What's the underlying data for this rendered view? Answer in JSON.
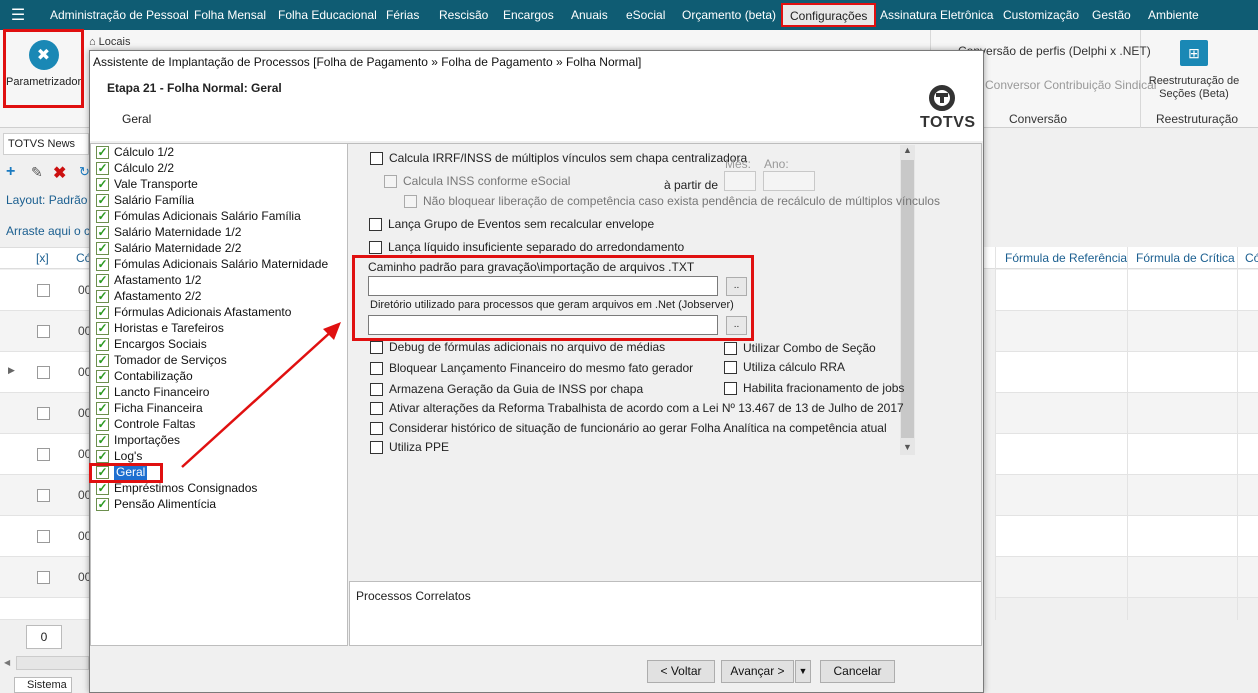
{
  "menu": {
    "items": [
      "Administração de Pessoal",
      "Folha Mensal",
      "Folha Educacional",
      "Férias",
      "Rescisão",
      "Encargos",
      "Anuais",
      "eSocial",
      "Orçamento (beta)",
      "Configurações",
      "Assinatura Eletrônica",
      "Customização",
      "Gestão",
      "Ambiente"
    ],
    "active": "Configurações"
  },
  "ribbon": {
    "parametrizador": "Parametrizador",
    "locais": "Locais",
    "conversao_perfis": "Conversão de perfis (Delphi x .NET)",
    "conversor_contrib": "Conversor Contribuição Sindical",
    "conversao_group": "Conversão",
    "reestruturacao": "Reestruturação de Seções (Beta)",
    "reestruturacao_group": "Reestruturação"
  },
  "background": {
    "news_tab": "TOTVS News",
    "layout_label": "Layout:",
    "layout_value": "Padrão",
    "drag_hint": "Arraste aqui o ca",
    "col_check": "[x]",
    "col_code": "Có",
    "row_code": "00",
    "right_headers": [
      "Fórmula de Referência",
      "Fórmula de Crítica",
      "Có"
    ],
    "page_number": "0",
    "bottom_tab": "Sistema"
  },
  "dialog": {
    "title": "Assistente de Implantação de Processos [Folha de Pagamento » Folha de Pagamento » Folha Normal]",
    "step_title": "Etapa 21 - Folha Normal: Geral",
    "step_subtitle": "Geral",
    "brand": "TOTVS",
    "tree": [
      "Cálculo 1/2",
      "Cálculo 2/2",
      "Vale Transporte",
      "Salário Família",
      "Fómulas Adicionais Salário Família",
      "Salário Maternidade 1/2",
      "Salário Maternidade 2/2",
      "Fómulas Adicionais Salário Maternidade",
      "Afastamento 1/2",
      "Afastamento 2/2",
      "Fórmulas Adicionais Afastamento",
      "Horistas e Tarefeiros",
      "Encargos Sociais",
      "Tomador de Serviços",
      "Contabilização",
      "Lancto Financeiro",
      "Ficha Financeira",
      "Controle Faltas",
      "Importações",
      "Log's",
      "Geral",
      "Empréstimos Consignados",
      "Pensão Alimentícia"
    ],
    "tree_selected": "Geral",
    "options": {
      "calc_irrf": "Calcula IRRF/INSS de múltiplos vínculos sem chapa centralizadora",
      "calc_inss": "Calcula INSS conforme eSocial",
      "a_partir_de": "à partir de",
      "mes": "Mês:",
      "ano": "Ano:",
      "nao_bloquear": "Não bloquear liberação de competência caso exista pendência de recálculo de múltiplos vínculos",
      "lanca_grupo": "Lança Grupo de Eventos sem recalcular envelope",
      "lanca_liquido": "Lança líquido insuficiente separado do arredondamento",
      "caminho_txt": "Caminho padrão para gravação\\importação de arquivos .TXT",
      "diretorio_net": "Diretório utilizado para processos que geram arquivos em .Net (Jobserver)",
      "browse": "..",
      "debug_formulas": "Debug de fórmulas adicionais no arquivo de médias",
      "bloquear_lanc": "Bloquear Lançamento Financeiro do mesmo fato gerador",
      "armazena_guia": "Armazena Geração da Guia de INSS por chapa",
      "ativar_reforma": "Ativar alterações da Reforma Trabalhista de acordo com a Lei Nº 13.467 de 13 de Julho de 2017",
      "considerar_hist": "Considerar histórico de situação de funcionário ao gerar Folha Analítica na competência atual",
      "utiliza_ppe": "Utiliza PPE",
      "combo_secao": "Utilizar Combo de Seção",
      "calculo_rra": "Utiliza cálculo RRA",
      "fracionamento": "Habilita fracionamento de jobs"
    },
    "correlated": "Processos Correlatos",
    "buttons": {
      "back": "< Voltar",
      "next": "Avançar >",
      "cancel": "Cancelar"
    }
  },
  "colors": {
    "menubar": "#0f5c73",
    "highlight": "#e01010",
    "accent": "#1a88b5",
    "selected": "#1e6fd0"
  }
}
